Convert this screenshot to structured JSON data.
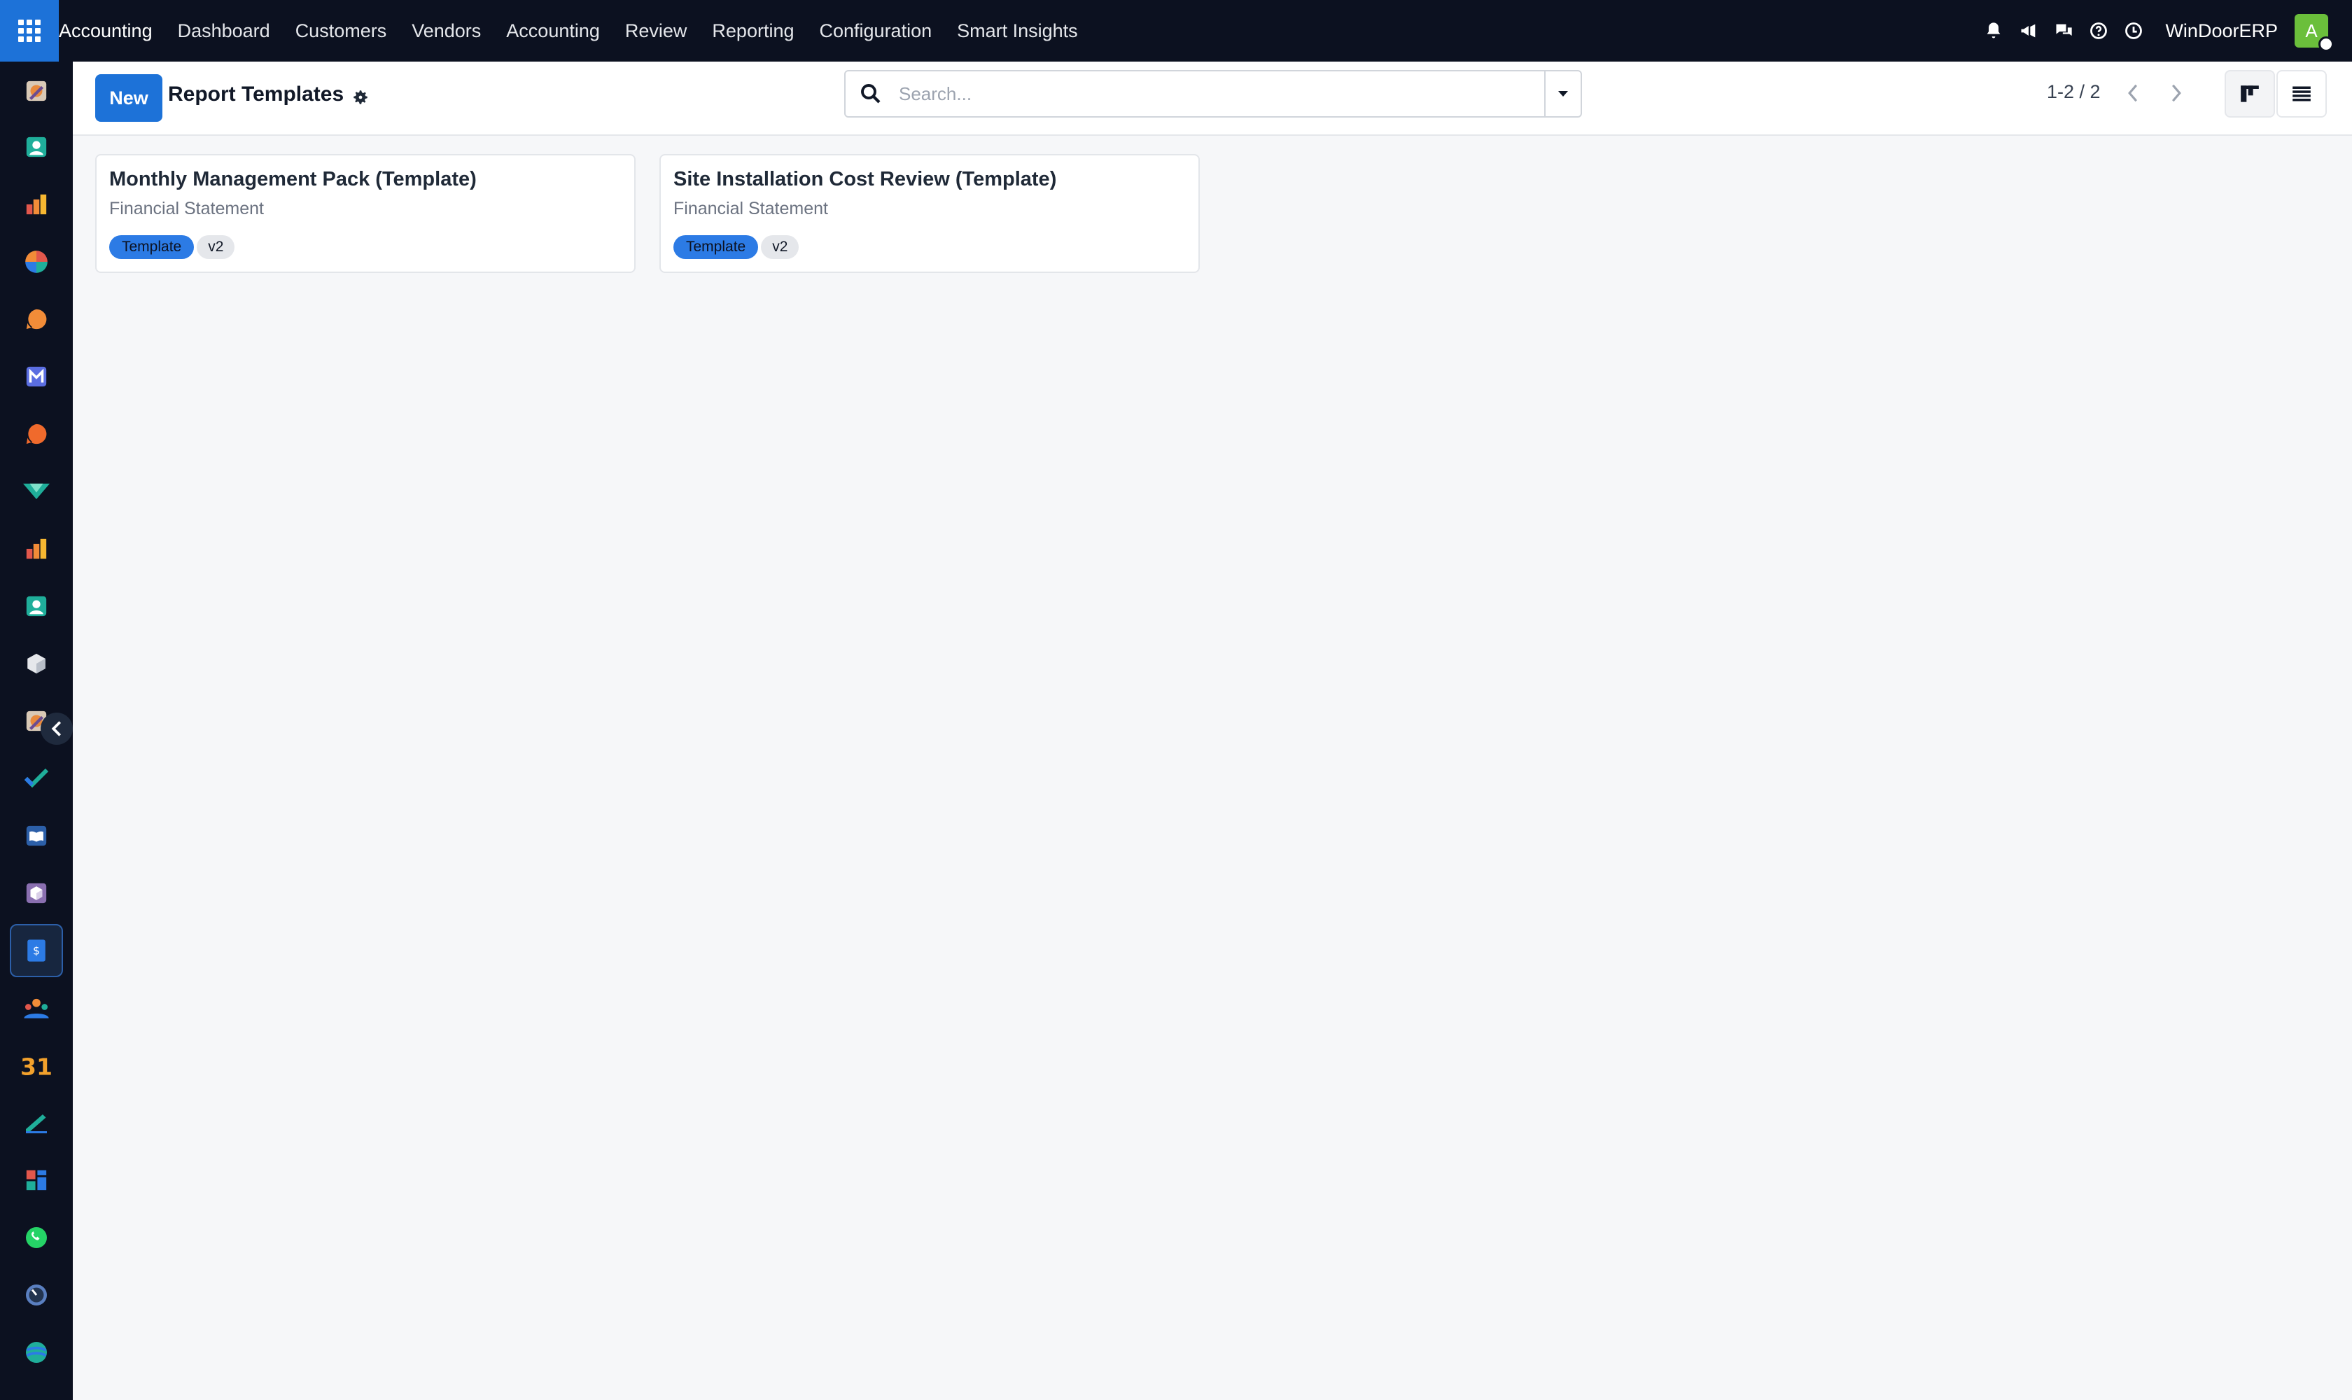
{
  "topbar": {
    "app_name": "Accounting",
    "menu": [
      "Dashboard",
      "Customers",
      "Vendors",
      "Accounting",
      "Review",
      "Reporting",
      "Configuration",
      "Smart Insights"
    ],
    "icons": [
      "bell-icon",
      "megaphone-icon",
      "chat-icon",
      "help-icon",
      "clock-icon"
    ],
    "company": "WinDoorERP",
    "avatar_letter": "A",
    "accent": "#1d72d8",
    "avatar_color": "#6bbf3b"
  },
  "sidebar": {
    "apps": [
      "accounting-app",
      "contacts-app",
      "reporting-app",
      "settings-app",
      "discuss-app",
      "mail-app",
      "livechat-app",
      "project-app",
      "stats-app",
      "employees-app",
      "inventory-app",
      "expenses-app",
      "todo-app",
      "knowledge-app",
      "products-app",
      "invoicing-app",
      "team-app",
      "calendar-app",
      "sign-app",
      "dashboards-app",
      "whatsapp-app",
      "timer-app",
      "website-app"
    ],
    "active_index": 15
  },
  "control": {
    "new_label": "New",
    "title": "Report Templates",
    "search_placeholder": "Search...",
    "pager": "1-2 / 2"
  },
  "cards": [
    {
      "title": "Monthly Management Pack (Template)",
      "subtitle": "Financial Statement",
      "tag": "Template",
      "version": "v2"
    },
    {
      "title": "Site Installation Cost Review (Template)",
      "subtitle": "Financial Statement",
      "tag": "Template",
      "version": "v2"
    }
  ]
}
